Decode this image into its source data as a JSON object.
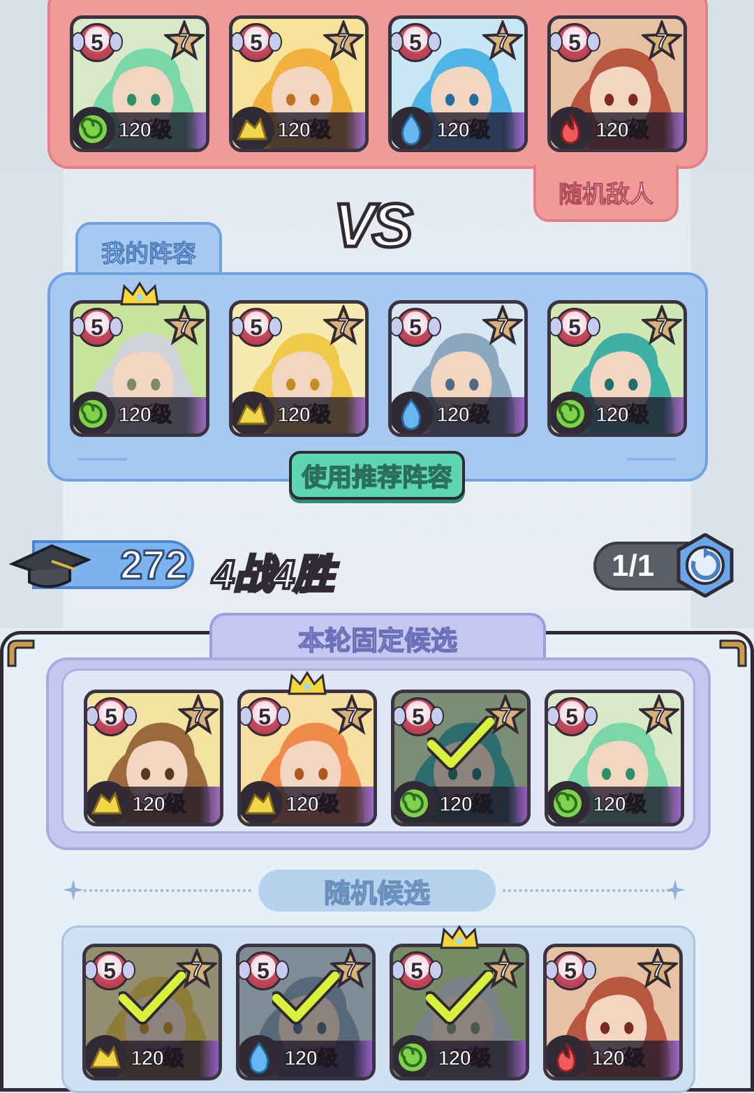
{
  "enemy_label": "随机敌人",
  "vs_label": "VS",
  "my_team_label": "我的阵容",
  "recommend_button": "使用推荐阵容",
  "score": "272",
  "record": "4战4胜",
  "refresh_count": "1/1",
  "fixed_label": "本轮固定候选",
  "random_label": "随机候选",
  "enemy_team": [
    {
      "level_badge": "5",
      "stars": "7",
      "level": "120级",
      "element": "wind",
      "portrait": "green-haired-sorceress"
    },
    {
      "level_badge": "5",
      "stars": "7",
      "level": "120级",
      "element": "earth",
      "portrait": "orange-bearded-warrior"
    },
    {
      "level_badge": "5",
      "stars": "7",
      "level": "120级",
      "element": "water",
      "portrait": "blue-haired-elf"
    },
    {
      "level_badge": "5",
      "stars": "7",
      "level": "120级",
      "element": "fire",
      "portrait": "red-helmet-warrior"
    }
  ],
  "my_team": [
    {
      "level_badge": "5",
      "stars": "7",
      "level": "120级",
      "element": "wind",
      "portrait": "silver-haired-elder",
      "crown": true
    },
    {
      "level_badge": "5",
      "stars": "7",
      "level": "120级",
      "element": "earth",
      "portrait": "blonde-girl"
    },
    {
      "level_badge": "5",
      "stars": "7",
      "level": "120级",
      "element": "water",
      "portrait": "shark-warrior"
    },
    {
      "level_badge": "5",
      "stars": "7",
      "level": "120级",
      "element": "wind",
      "portrait": "teal-haired-priestess"
    }
  ],
  "fixed_candidates": [
    {
      "level_badge": "5",
      "stars": "7",
      "level": "120级",
      "element": "earth",
      "portrait": "goggles-kid"
    },
    {
      "level_badge": "5",
      "stars": "7",
      "level": "120级",
      "element": "earth",
      "portrait": "orange-haired-girl",
      "crown": true
    },
    {
      "level_badge": "5",
      "stars": "7",
      "level": "120级",
      "element": "wind",
      "portrait": "teal-haired-priestess",
      "selected": true
    },
    {
      "level_badge": "5",
      "stars": "7",
      "level": "120级",
      "element": "wind",
      "portrait": "green-haired-sorceress"
    }
  ],
  "random_candidates": [
    {
      "level_badge": "5",
      "stars": "7",
      "level": "120级",
      "element": "earth",
      "portrait": "blonde-girl",
      "selected": true
    },
    {
      "level_badge": "5",
      "stars": "7",
      "level": "120级",
      "element": "water",
      "portrait": "shark-warrior",
      "selected": true
    },
    {
      "level_badge": "5",
      "stars": "7",
      "level": "120级",
      "element": "wind",
      "portrait": "silver-haired-elder",
      "selected": true,
      "crown": true
    },
    {
      "level_badge": "5",
      "stars": "7",
      "level": "120级",
      "element": "fire",
      "portrait": "red-helmet-warrior"
    }
  ],
  "colors": {
    "enemy_panel": "#f19a9a",
    "my_panel": "#a7c9f1",
    "recommend_button": "#5fd6b2",
    "fixed_panel": "#c4c7ef"
  }
}
